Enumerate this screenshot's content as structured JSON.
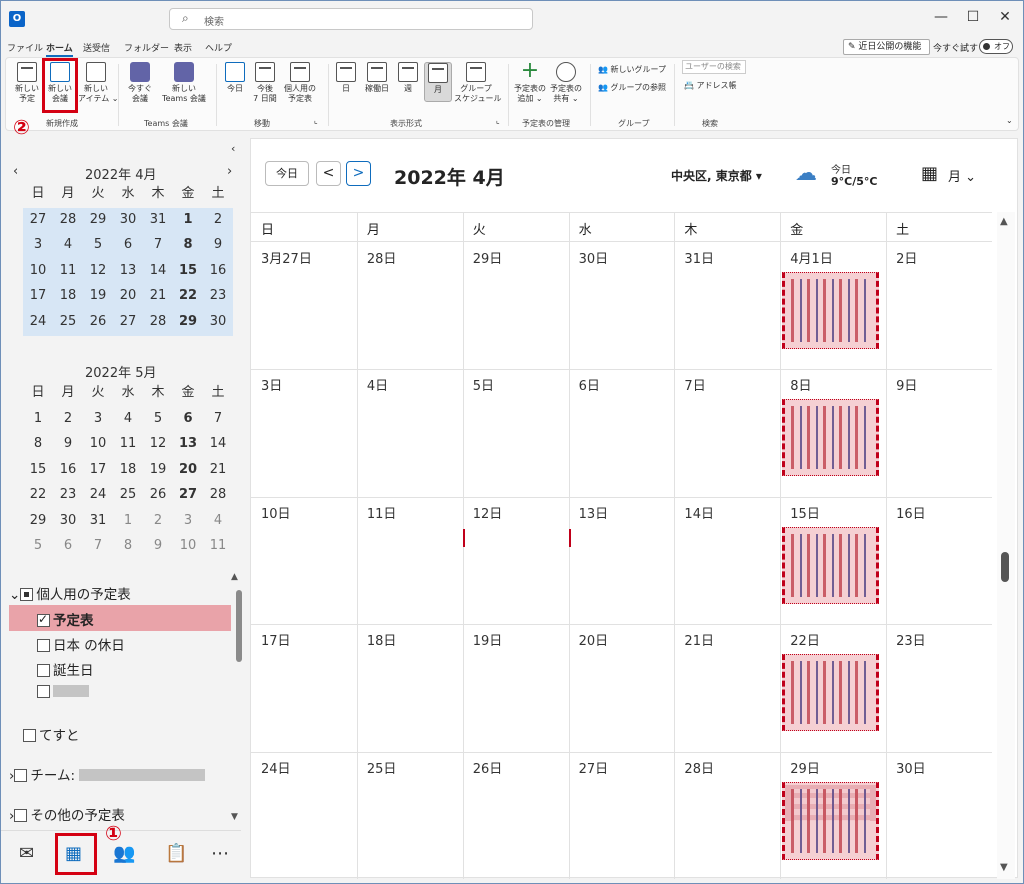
{
  "titlebar": {
    "search_placeholder": "検索",
    "min": "—",
    "max": "☐",
    "close": "✕"
  },
  "menu": {
    "items": [
      "ファイル",
      "ホーム",
      "送受信",
      "フォルダー",
      "表示",
      "ヘルプ"
    ],
    "new_feature": "近日公開の機能",
    "try_now": "今すぐ試す",
    "toggle": "オフ"
  },
  "ribbon": {
    "new_appointment": "新しい\n予定",
    "new_meeting": "新しい\n会議",
    "new_items": "新しい\nアイテム ⌄",
    "meet_now": "今すぐ\n会議",
    "new_teams": "新しい\nTeams 会議",
    "today": "今日",
    "next7": "今後\n7 日間",
    "personal_cal": "個人用の\n予定表",
    "day": "日",
    "workweek": "稼働日",
    "week": "週",
    "month": "月",
    "group_schedule": "グループ\nスケジュール",
    "add_cal": "予定表の\n追加 ⌄",
    "share_cal": "予定表の\n共有 ⌄",
    "new_group": "新しいグループ",
    "browse_groups": "グループの参照",
    "user_search": "ユーザーの検索",
    "address_book": "アドレス帳",
    "grp_new": "新規作成",
    "grp_teams": "Teams 会議",
    "grp_move": "移動",
    "grp_view": "表示形式",
    "grp_manage": "予定表の管理",
    "grp_group": "グループ",
    "grp_search": "検索"
  },
  "annotations": {
    "one": "①",
    "two": "②"
  },
  "mini": {
    "weekdays": [
      "日",
      "月",
      "火",
      "水",
      "木",
      "金",
      "土"
    ],
    "april_title": "2022年 4月",
    "may_title": "2022年 5月",
    "april": [
      [
        "27",
        "28",
        "29",
        "30",
        "31",
        "1",
        "2"
      ],
      [
        "3",
        "4",
        "5",
        "6",
        "7",
        "8",
        "9"
      ],
      [
        "10",
        "11",
        "12",
        "13",
        "14",
        "15",
        "16"
      ],
      [
        "17",
        "18",
        "19",
        "20",
        "21",
        "22",
        "23"
      ],
      [
        "24",
        "25",
        "26",
        "27",
        "28",
        "29",
        "30"
      ]
    ],
    "may": [
      [
        "1",
        "2",
        "3",
        "4",
        "5",
        "6",
        "7"
      ],
      [
        "8",
        "9",
        "10",
        "11",
        "12",
        "13",
        "14"
      ],
      [
        "15",
        "16",
        "17",
        "18",
        "19",
        "20",
        "21"
      ],
      [
        "22",
        "23",
        "24",
        "25",
        "26",
        "27",
        "28"
      ],
      [
        "29",
        "30",
        "31",
        "1",
        "2",
        "3",
        "4"
      ],
      [
        "5",
        "6",
        "7",
        "8",
        "9",
        "10",
        "11"
      ]
    ]
  },
  "calendars": {
    "personal_group": "個人用の予定表",
    "items": [
      "予定表",
      "日本 の休日",
      "誕生日"
    ],
    "other1": "てすと",
    "team": "チーム:",
    "other_group": "その他の予定表"
  },
  "main": {
    "today_btn": "今日",
    "prev": "<",
    "next": ">",
    "title": "2022年 4月",
    "location": "中央区, 東京都",
    "weather_label": "今日",
    "weather_temp": "9°C/5°C",
    "view": "月",
    "weekdays": [
      "日",
      "月",
      "火",
      "水",
      "木",
      "金",
      "土"
    ],
    "weeks": [
      [
        "3月27日",
        "28日",
        "29日",
        "30日",
        "31日",
        "4月1日",
        "2日"
      ],
      [
        "3日",
        "4日",
        "5日",
        "6日",
        "7日",
        "8日",
        "9日"
      ],
      [
        "10日",
        "11日",
        "12日",
        "13日",
        "14日",
        "15日",
        "16日"
      ],
      [
        "17日",
        "18日",
        "19日",
        "20日",
        "21日",
        "22日",
        "23日"
      ],
      [
        "24日",
        "25日",
        "26日",
        "27日",
        "28日",
        "29日",
        "30日"
      ]
    ]
  }
}
